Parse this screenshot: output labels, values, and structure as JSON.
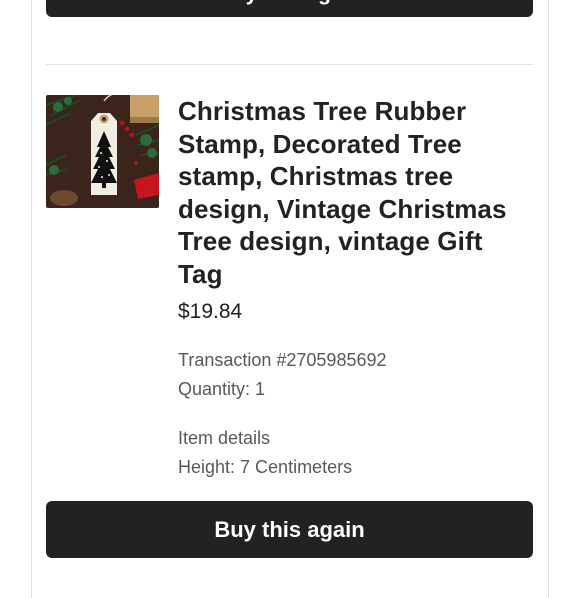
{
  "top_button": {
    "label": "Buy this again"
  },
  "item": {
    "image_name": "christmas-tree-stamp-thumbnail",
    "title": "Christmas Tree Rubber Stamp, Decorated Tree stamp, Christmas tree design, Vintage Christmas Tree design, vintage Gift Tag",
    "price": "$19.84",
    "transaction": "Transaction #2705985692",
    "quantity": "Quantity: 1",
    "details_heading": "Item details",
    "height": "Height: 7 Centimeters"
  },
  "buy_again_button": {
    "label": "Buy this again"
  },
  "colors": {
    "button_bg": "#222222",
    "text_primary": "#222222",
    "text_secondary": "#595959",
    "border": "#e1e1e1"
  }
}
